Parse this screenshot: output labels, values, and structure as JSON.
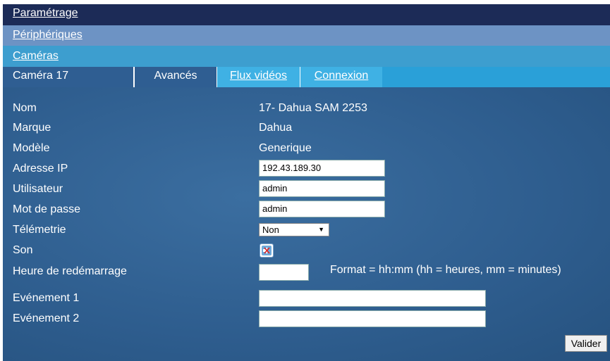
{
  "nav": {
    "parametrage": "Paramétrage",
    "peripheriques": "Périphériques",
    "cameras": "Caméras"
  },
  "tabs": {
    "camera": "Caméra 17",
    "avances": "Avancés",
    "flux": "Flux vidéos",
    "connexion": "Connexion"
  },
  "form": {
    "nom_label": "Nom",
    "nom_value": "17- Dahua SAM 2253",
    "marque_label": "Marque",
    "marque_value": "Dahua",
    "modele_label": "Modèle",
    "modele_value": "Generique",
    "ip_label": "Adresse IP",
    "ip_value": "192.43.189.30",
    "user_label": "Utilisateur",
    "user_value": "admin",
    "pass_label": "Mot de passe",
    "pass_value": "admin",
    "telemetrie_label": "Télémetrie",
    "telemetrie_value": "Non",
    "son_label": "Son",
    "reboot_label": "Heure de redémarrage",
    "reboot_value": "",
    "format_hint": "Format = hh:mm  (hh = heures, mm = minutes)",
    "event1_label": "Evénement 1",
    "event1_value": "",
    "event2_label": "Evénement 2",
    "event2_value": "",
    "submit": "Valider"
  },
  "icons": {
    "sound": "sound-muted-icon",
    "dropdown": "chevron-down-icon"
  }
}
